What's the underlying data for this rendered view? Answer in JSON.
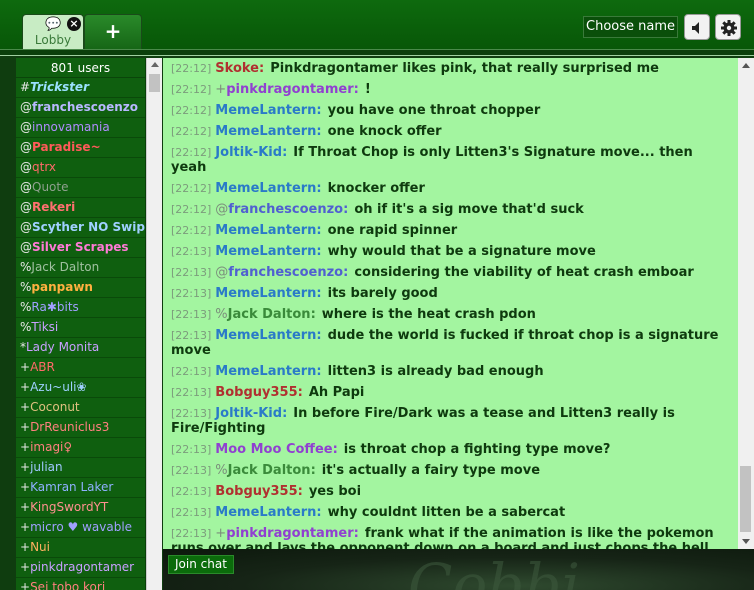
{
  "tabs": [
    {
      "label": "Lobby",
      "close": "×"
    },
    {
      "label": "+"
    }
  ],
  "header": {
    "choose_name": "Choose name"
  },
  "userlist": {
    "count": "801 users",
    "users": [
      {
        "sym": "#",
        "name": "Trickster",
        "color": "#9be0ff",
        "bold": true,
        "italic": true
      },
      {
        "sym": "@",
        "name": "franchescoenzo",
        "color": "#b8b8ff",
        "bold": true
      },
      {
        "sym": "@",
        "name": "innovamania",
        "color": "#b08cff"
      },
      {
        "sym": "@",
        "name": "Paradise~",
        "color": "#ff5a5a",
        "bold": true
      },
      {
        "sym": "@",
        "name": "qtrx",
        "color": "#ff6a6a"
      },
      {
        "sym": "@",
        "name": "Quote",
        "color": "#8fa08f"
      },
      {
        "sym": "@",
        "name": "Rekeri",
        "color": "#ff7070",
        "bold": true
      },
      {
        "sym": "@",
        "name": "Scyther NO Swiping",
        "color": "#a0d0ff",
        "bold": true
      },
      {
        "sym": "@",
        "name": "Silver Scrapes",
        "color": "#ff7ad6",
        "bold": true
      },
      {
        "sym": "%",
        "name": "Jack Dalton",
        "color": "#a0c0a0"
      },
      {
        "sym": "%",
        "name": "panpawn",
        "color": "#ffb040",
        "bold": true
      },
      {
        "sym": "%",
        "name": "Ra✱bits",
        "color": "#a0a0ff"
      },
      {
        "sym": "%",
        "name": "Tiksi",
        "color": "#c8a0ff"
      },
      {
        "sym": "*",
        "name": "Lady Monita",
        "color": "#c8a0ff"
      },
      {
        "sym": "+",
        "name": "ABR",
        "color": "#ff6a6a"
      },
      {
        "sym": "+",
        "name": "Azu~uli❀",
        "color": "#9fd0ff"
      },
      {
        "sym": "+",
        "name": "Coconut",
        "color": "#e0c080"
      },
      {
        "sym": "+",
        "name": "DrReuniclus3",
        "color": "#ff8080"
      },
      {
        "sym": "+",
        "name": "imagi♀",
        "color": "#ff8080"
      },
      {
        "sym": "+",
        "name": "julian",
        "color": "#a0c8ff"
      },
      {
        "sym": "+",
        "name": "Kamran Laker",
        "color": "#8fb0ff"
      },
      {
        "sym": "+",
        "name": "KingSwordYT",
        "color": "#ff9090"
      },
      {
        "sym": "+",
        "name": "micro ♥ wavable",
        "color": "#a0a0ff"
      },
      {
        "sym": "+",
        "name": "Nui",
        "color": "#ffb060"
      },
      {
        "sym": "+",
        "name": "pinkdragontamer",
        "color": "#c8a0ff"
      },
      {
        "sym": "+",
        "name": "Sei tobo kori",
        "color": "#ff8080"
      }
    ]
  },
  "messages": [
    {
      "ts": "[22:12]",
      "sym": "",
      "name": "Skoke:",
      "color": "#b03030",
      "text": "Pinkdragontamer likes pink, that really surprised me"
    },
    {
      "ts": "[22:12]",
      "sym": "+",
      "name": "pinkdragontamer:",
      "color": "#9040d0",
      "text": "!"
    },
    {
      "ts": "[22:12]",
      "sym": "",
      "name": "MemeLantern:",
      "color": "#2a7ac8",
      "text": "you have one throat chopper"
    },
    {
      "ts": "[22:12]",
      "sym": "",
      "name": "MemeLantern:",
      "color": "#2a7ac8",
      "text": "one knock offer"
    },
    {
      "ts": "[22:12]",
      "sym": "",
      "name": "Joltik-Kid:",
      "color": "#2a7ac8",
      "text": "If Throat Chop is only Litten3's Signature move... then yeah"
    },
    {
      "ts": "[22:12]",
      "sym": "",
      "name": "MemeLantern:",
      "color": "#2a7ac8",
      "text": "knocker offer"
    },
    {
      "ts": "[22:12]",
      "sym": "@",
      "name": "franchescoenzo:",
      "color": "#5060d0",
      "text": "oh if it's a sig move that'd suck"
    },
    {
      "ts": "[22:12]",
      "sym": "",
      "name": "MemeLantern:",
      "color": "#2a7ac8",
      "text": "one rapid spinner"
    },
    {
      "ts": "[22:13]",
      "sym": "",
      "name": "MemeLantern:",
      "color": "#2a7ac8",
      "text": "why would that be a signature move"
    },
    {
      "ts": "[22:13]",
      "sym": "@",
      "name": "franchescoenzo:",
      "color": "#5060d0",
      "text": "considering the viability of heat crash emboar"
    },
    {
      "ts": "[22:13]",
      "sym": "",
      "name": "MemeLantern:",
      "color": "#2a7ac8",
      "text": "its barely good"
    },
    {
      "ts": "[22:13]",
      "sym": "%",
      "name": "Jack Dalton:",
      "color": "#3a8a3a",
      "text": "where is the heat crash pdon"
    },
    {
      "ts": "[22:13]",
      "sym": "",
      "name": "MemeLantern:",
      "color": "#2a7ac8",
      "text": "dude the world is fucked if throat chop is a signature move"
    },
    {
      "ts": "[22:13]",
      "sym": "",
      "name": "MemeLantern:",
      "color": "#2a7ac8",
      "text": "litten3 is already bad enough"
    },
    {
      "ts": "[22:13]",
      "sym": "",
      "name": "Bobguy355:",
      "color": "#b03030",
      "text": "Ah Papi"
    },
    {
      "ts": "[22:13]",
      "sym": "",
      "name": "Joltik-Kid:",
      "color": "#2a7ac8",
      "text": "In before Fire/Dark was a tease and Litten3 really is Fire/Fighting"
    },
    {
      "ts": "[22:13]",
      "sym": "",
      "name": "Moo Moo Coffee:",
      "color": "#9040d0",
      "text": "is throat chop a fighting type move?"
    },
    {
      "ts": "[22:13]",
      "sym": "%",
      "name": "Jack Dalton:",
      "color": "#3a8a3a",
      "text": "it's actually a fairy type move"
    },
    {
      "ts": "[22:13]",
      "sym": "",
      "name": "Bobguy355:",
      "color": "#b03030",
      "text": "yes boi"
    },
    {
      "ts": "[22:13]",
      "sym": "",
      "name": "MemeLantern:",
      "color": "#2a7ac8",
      "text": "why couldnt litten be a sabercat"
    },
    {
      "ts": "[22:13]",
      "sym": "+",
      "name": "pinkdragontamer:",
      "color": "#9040d0",
      "text": "frank what if the animation is like the pokemon runs over and lays the opponent down on a board and just chops the hell out of his throat"
    }
  ],
  "bottom": {
    "join_chat": "Join chat"
  }
}
